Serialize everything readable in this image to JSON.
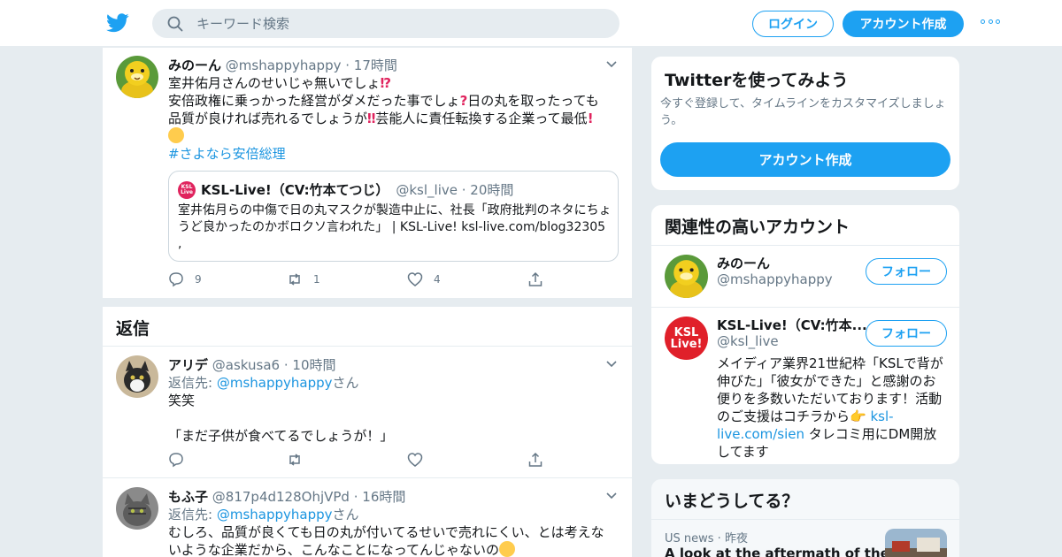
{
  "header": {
    "search_placeholder": "キーワード検索",
    "login_label": "ログイン",
    "signup_label": "アカウント作成"
  },
  "main_tweet": {
    "name": "みのーん",
    "screen_name": "@mshappyhappy",
    "time": "17時間",
    "line1": "室井佑月さんのせいじゃ無いでしょ",
    "line2a": "安倍政権に乗っかった経営がダメだった事でしょ",
    "line2b": "日の丸を取ったっても",
    "line3a": "品質が良ければ売れるでしょうが",
    "line3b": "芸能人に責任転換する企業って最低",
    "hashtag": "#さよなら安倍総理",
    "quote": {
      "name": "KSL-Live!（CV:竹本てつじ）",
      "screen_name": "@ksl_live",
      "time": "20時間",
      "text": "室井佑月らの中傷で日の丸マスクが製造中止に、社長「政府批判のネタにちょうど良かったのかボロクソ言われた」 | KSL-Live! ksl-live.com/blog32305 ,"
    },
    "reply_count": "9",
    "retweet_count": "1",
    "like_count": "4"
  },
  "replies": {
    "title": "返信",
    "items": [
      {
        "name": "アリデ",
        "screen_name": "@askusa6",
        "time": "10時間",
        "reply_to_prefix": "返信先: ",
        "reply_to_handle": "@mshappyhappy",
        "reply_to_suffix": "さん",
        "text1": "笑笑",
        "text2": "「まだ子供が食べてるでしょうが！」"
      },
      {
        "name": "もふ子",
        "screen_name": "@817p4d128OhjVPd",
        "time": "16時間",
        "reply_to_prefix": "返信先: ",
        "reply_to_handle": "@mshappyhappy",
        "reply_to_suffix": "さん",
        "text1": "むしろ、品質が良くても日の丸が付いてるせいで売れにくい、とは考えな",
        "text2": "いような企業だから、こんなことになってんじゃないの"
      }
    ]
  },
  "sidebar": {
    "try_twitter": {
      "title": "Twitterを使ってみよう",
      "description": "今すぐ登録して、タイムラインをカスタマイズしましょう。",
      "button": "アカウント作成"
    },
    "related": {
      "title": "関連性の高いアカウント",
      "follow_label": "フォロー",
      "accounts": [
        {
          "name": "みのーん",
          "screen_name": "@mshappyhappy"
        },
        {
          "name": "KSL-Live!（CV:竹本...",
          "screen_name": "@ksl_live",
          "avatar_text": "KSL Live!",
          "bio1": "メイディア業界21世紀枠「KSLで背が伸びた」「彼女ができた」と感謝のお便りを多数いただいております！活動のご支援はコチラから",
          "bio_link": "ksl-live.com/sien",
          "bio2": " タレコミ用にDM開放してます"
        }
      ]
    },
    "trends": {
      "title": "いまどうしてる？",
      "item_category": "US news",
      "item_time": "昨夜",
      "item_headline": "A look at the aftermath of the"
    }
  },
  "colors": {
    "accent": "#1da1f2",
    "link": "#1b95e0",
    "muted": "#657786",
    "border": "#e6ecf0"
  }
}
